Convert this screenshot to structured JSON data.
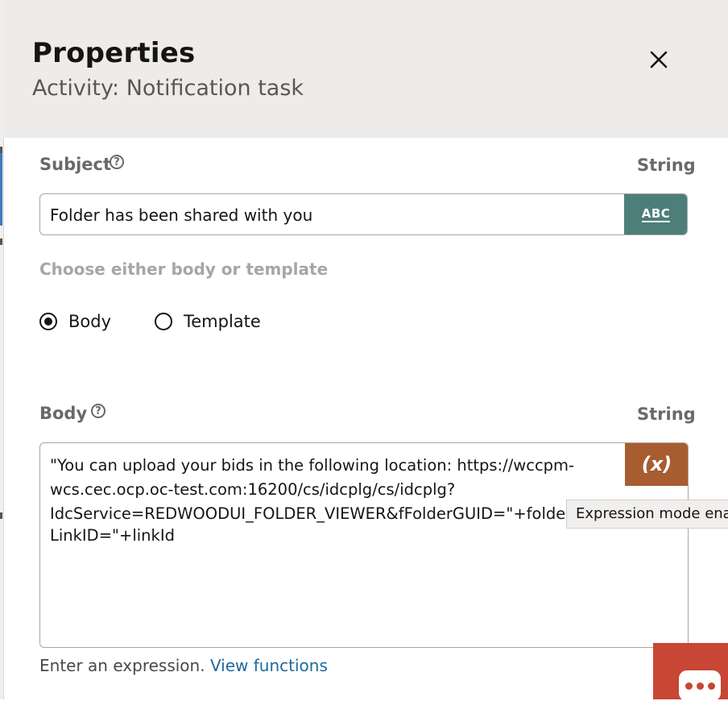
{
  "header": {
    "title": "Properties",
    "subtitle": "Activity: Notification task"
  },
  "subject": {
    "label": "Subject",
    "type": "String",
    "value": "Folder has been shared with you",
    "mode_button_label": "ABC"
  },
  "choice": {
    "heading": "Choose either body or template",
    "options": [
      {
        "label": "Body",
        "selected": true
      },
      {
        "label": "Template",
        "selected": false
      }
    ]
  },
  "body": {
    "label": "Body",
    "type": "String",
    "lines": [
      "\"You can upload your bids in the following location: https://wccpm-",
      "wcs.cec.ocp.oc-test.com:16200/cs/idcplg/cs/idcplg?",
      "IdcService=REDWOODUI_FOLDER_VIEWER&fFolderGUID=\"+folderGUID+\"&",
      "LinkID=\"+linkId"
    ],
    "mode_button_label": "(x)",
    "tooltip": "Expression mode enabled",
    "help_text": "Enter an expression.",
    "help_link": "View functions"
  },
  "icons": {
    "close": "close-icon",
    "help": "help-icon",
    "chat": "chat-icon"
  },
  "colors": {
    "abc_button": "#4e7e7a",
    "expression_button": "#a85d31",
    "chat_button": "#c74634",
    "link": "#1e6a9e"
  }
}
